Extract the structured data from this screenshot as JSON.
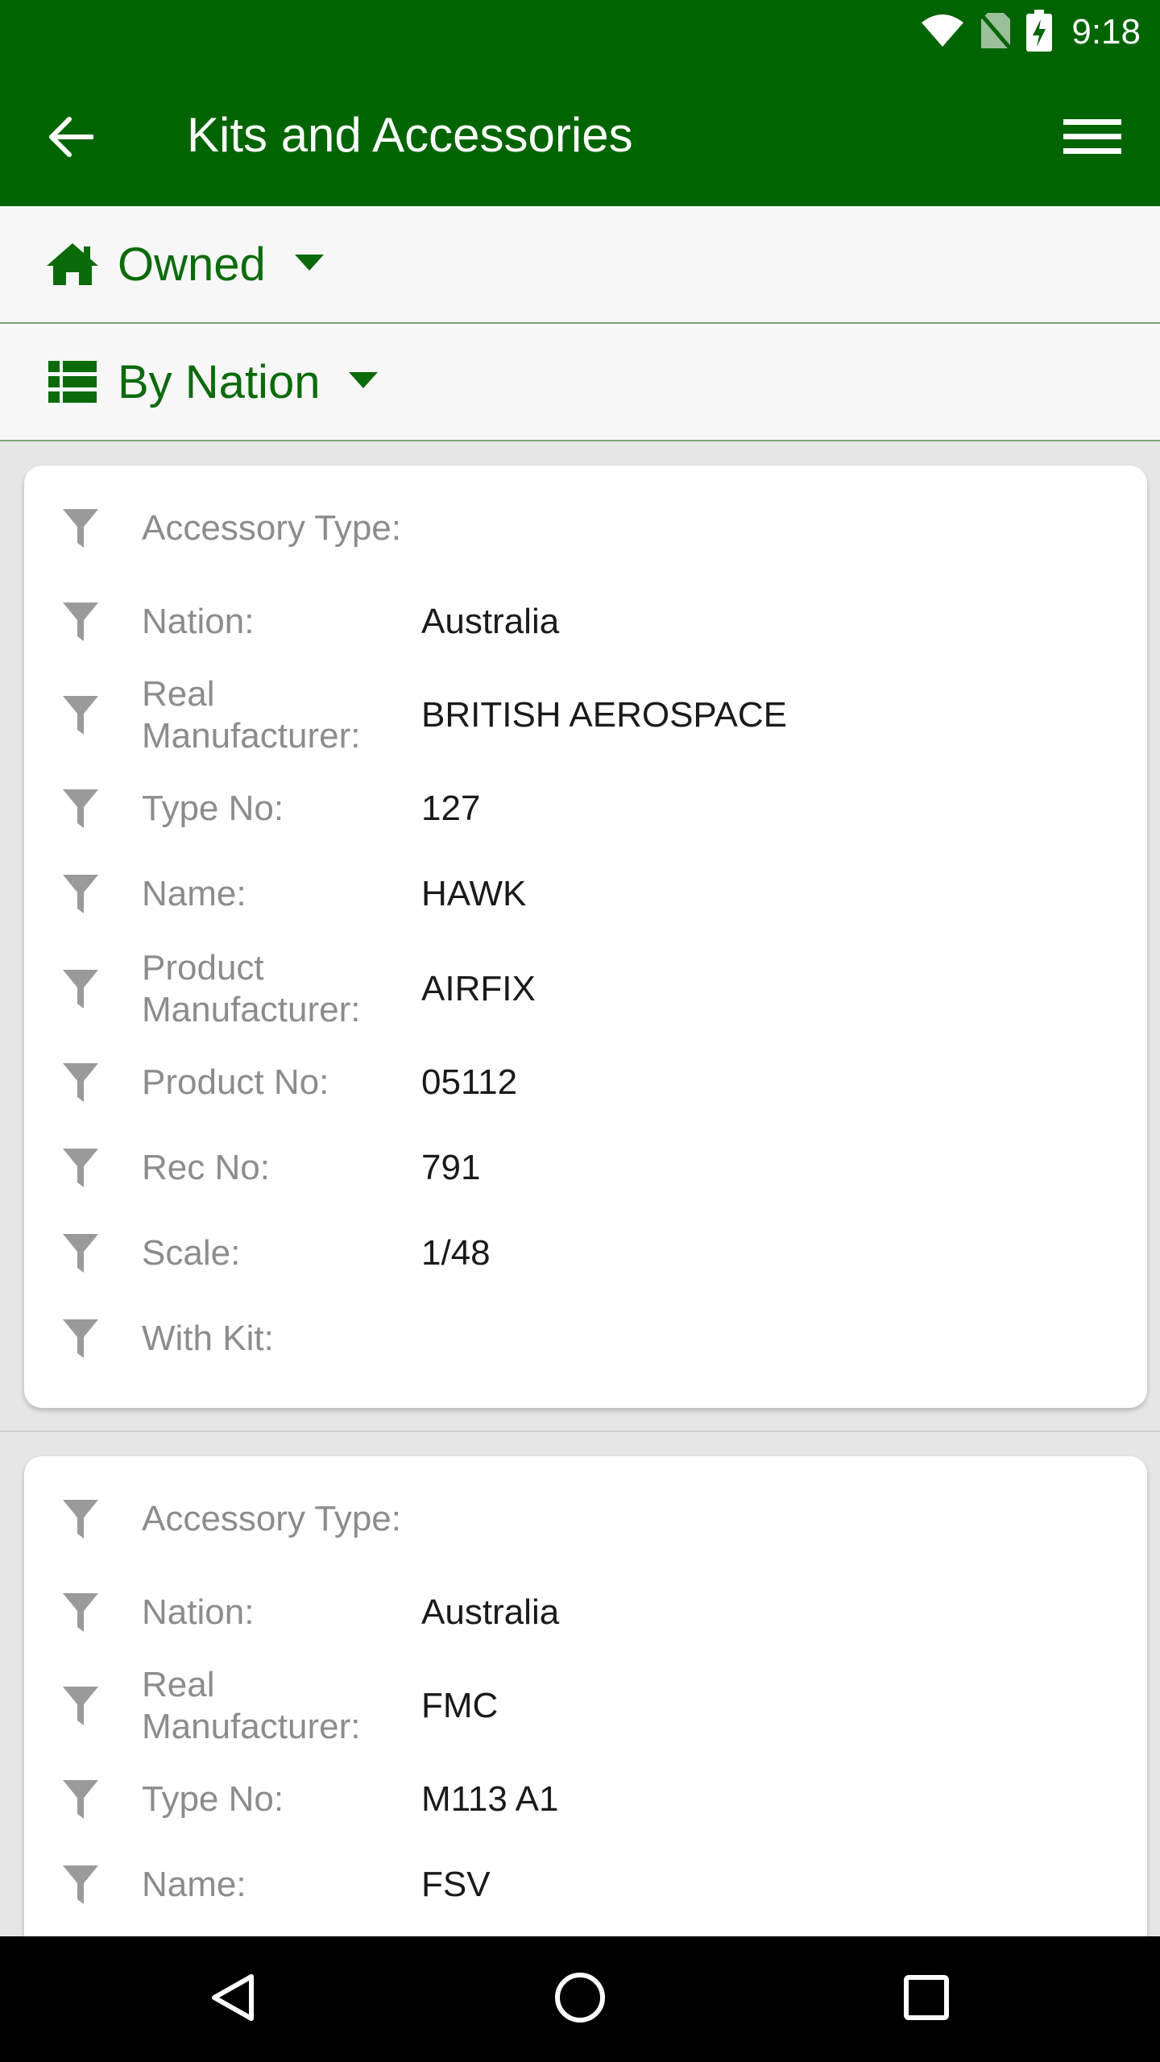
{
  "status": {
    "time": "9:18"
  },
  "app_bar": {
    "title": "Kits and Accessories"
  },
  "filters": {
    "owned_label": "Owned",
    "group_label": "By Nation"
  },
  "cards": [
    {
      "fields": [
        {
          "label": "Accessory Type:",
          "value": ""
        },
        {
          "label": "Nation:",
          "value": "Australia"
        },
        {
          "label": "Real Manufacturer:",
          "value": "BRITISH AEROSPACE"
        },
        {
          "label": "Type No:",
          "value": "127"
        },
        {
          "label": "Name:",
          "value": "HAWK"
        },
        {
          "label": "Product Manufacturer:",
          "value": "AIRFIX"
        },
        {
          "label": "Product No:",
          "value": "05112"
        },
        {
          "label": "Rec No:",
          "value": "791"
        },
        {
          "label": "Scale:",
          "value": "1/48"
        },
        {
          "label": "With Kit:",
          "value": ""
        }
      ]
    },
    {
      "fields": [
        {
          "label": "Accessory Type:",
          "value": ""
        },
        {
          "label": "Nation:",
          "value": "Australia"
        },
        {
          "label": "Real Manufacturer:",
          "value": "FMC"
        },
        {
          "label": "Type No:",
          "value": "M113 A1"
        },
        {
          "label": "Name:",
          "value": "FSV"
        }
      ]
    }
  ],
  "colors": {
    "primary": "#006400",
    "accent_text": "#0b6b0b",
    "label": "#8c8c8c",
    "value": "#1a1a1a"
  }
}
